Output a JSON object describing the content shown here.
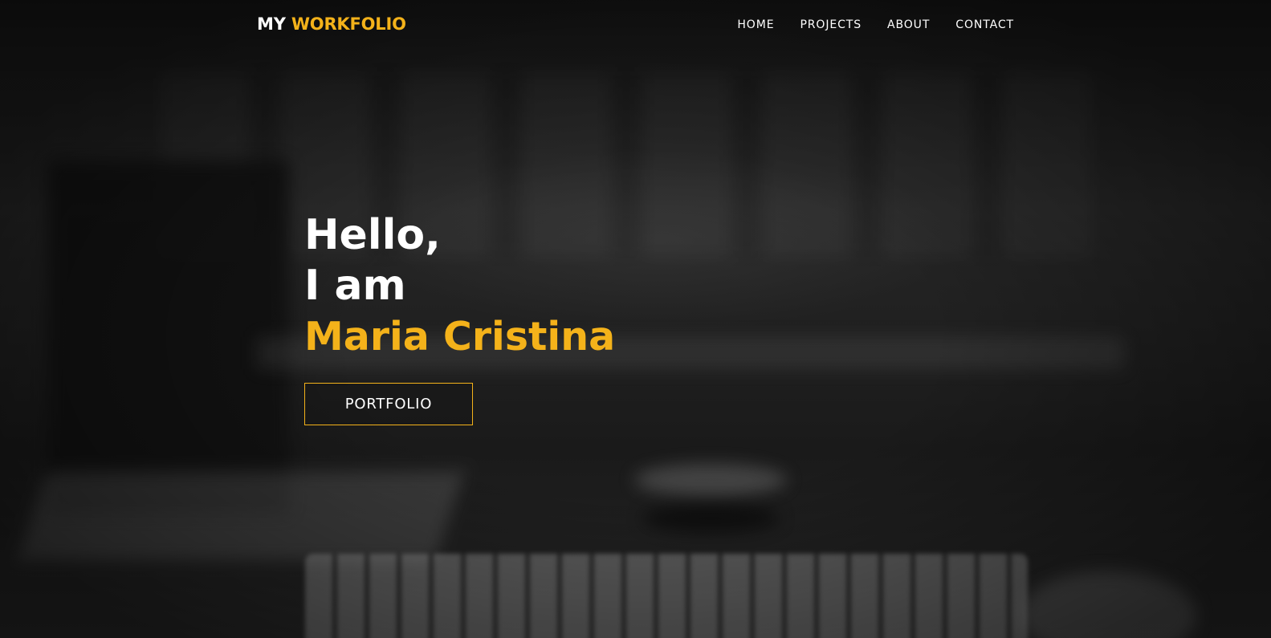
{
  "header": {
    "brand_primary": "MY",
    "brand_accent": "WORKFOLIO",
    "nav": [
      {
        "label": "HOME"
      },
      {
        "label": "PROJECTS"
      },
      {
        "label": "ABOUT"
      },
      {
        "label": "CONTACT"
      }
    ]
  },
  "hero": {
    "line1": "Hello,",
    "line2": "I am",
    "name": "Maria Cristina",
    "button_label": "PORTFOLIO"
  },
  "colors": {
    "accent": "#f4b21a",
    "text": "#ffffff",
    "background": "#1b1b1b"
  }
}
